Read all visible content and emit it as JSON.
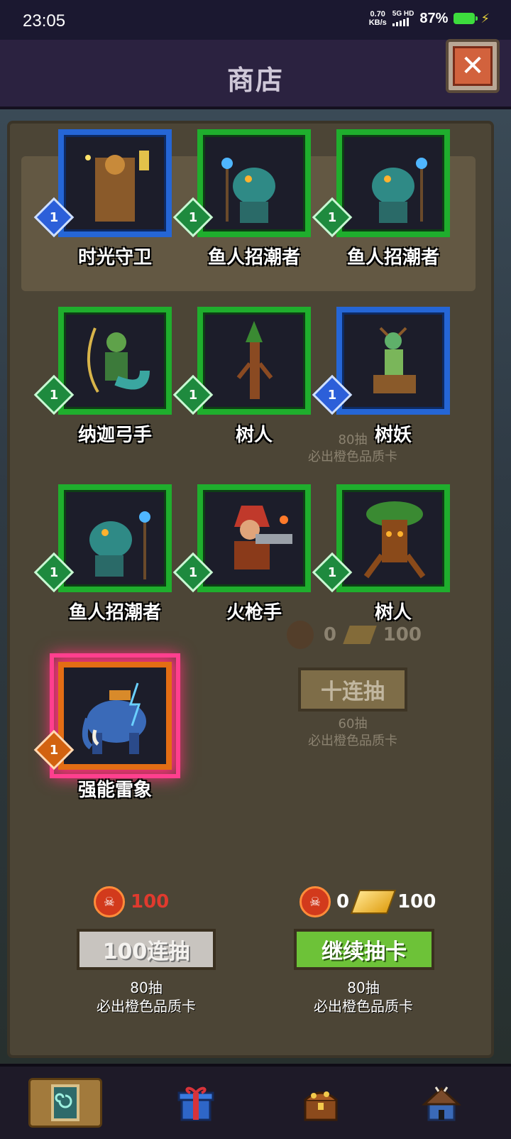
{
  "status": {
    "time": "23:05",
    "net_speed_value": "0.70",
    "net_speed_unit": "KB/s",
    "signal_label": "5G HD",
    "battery": "87%"
  },
  "header": {
    "title": "商店"
  },
  "cards": [
    {
      "name": "时光守卫",
      "level": "1",
      "rarity": "blue"
    },
    {
      "name": "鱼人招潮者",
      "level": "1",
      "rarity": "green"
    },
    {
      "name": "鱼人招潮者",
      "level": "1",
      "rarity": "green"
    },
    {
      "name": "纳迦弓手",
      "level": "1",
      "rarity": "green"
    },
    {
      "name": "树人",
      "level": "1",
      "rarity": "green"
    },
    {
      "name": "树妖",
      "level": "1",
      "rarity": "blue"
    },
    {
      "name": "鱼人招潮者",
      "level": "1",
      "rarity": "green"
    },
    {
      "name": "火枪手",
      "level": "1",
      "rarity": "green"
    },
    {
      "name": "树人",
      "level": "1",
      "rarity": "green"
    },
    {
      "name": "强能雷象",
      "level": "1",
      "rarity": "orange"
    }
  ],
  "background": {
    "ten_draw_label": "十连抽",
    "ten_draw_note_1": "60抽",
    "ten_draw_note_2": "必出橙色品质卡",
    "mid_note_1": "80抽",
    "mid_note_2": "必出橙色品质卡",
    "mid_cost_0": "0",
    "mid_cost_100": "100"
  },
  "footer": {
    "left": {
      "cost": "100",
      "button_label": "100连抽",
      "note_1": "80抽",
      "note_2": "必出橙色品质卡"
    },
    "right": {
      "cost_coin": "0",
      "cost_gold": "100",
      "button_label": "继续抽卡",
      "note_1": "80抽",
      "note_2": "必出橙色品质卡"
    }
  },
  "nav": [
    "cards-icon",
    "gift-icon",
    "treasure-chest-icon",
    "hut-icon"
  ],
  "colors": {
    "green_frame": "#1fae2d",
    "blue_frame": "#2566d6",
    "orange_frame": "#e36d14",
    "glow": "#ff3f8e",
    "button_green": "#6dc238"
  }
}
